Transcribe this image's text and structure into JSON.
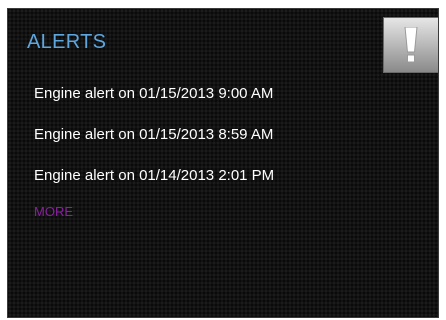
{
  "panel": {
    "title": "ALERTS",
    "icon": "exclamation-icon",
    "alerts": [
      {
        "text": "Engine alert on 01/15/2013 9:00 AM"
      },
      {
        "text": "Engine alert on 01/15/2013 8:59 AM"
      },
      {
        "text": "Engine alert on 01/14/2013 2:01 PM"
      }
    ],
    "more_label": "MORE"
  },
  "colors": {
    "title": "#5ea6de",
    "more_link": "#8a1fa0",
    "background": "#121212",
    "text": "#ffffff"
  }
}
